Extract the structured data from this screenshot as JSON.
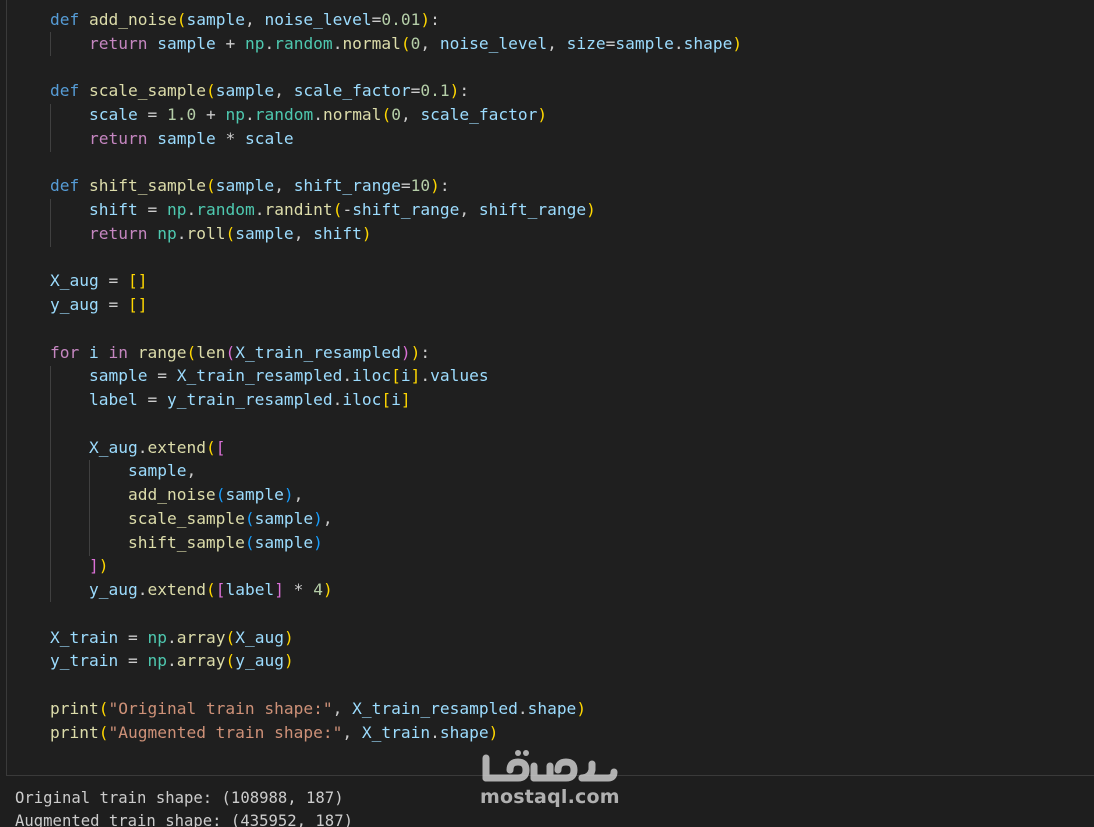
{
  "colors": {
    "background": "#1f1f1f",
    "keyword": "#569cd6",
    "control": "#c586c0",
    "function": "#dcdcaa",
    "variable": "#9cdcfe",
    "module": "#4ec9b0",
    "number": "#b5cea8",
    "string": "#ce9178",
    "plain": "#cccccc",
    "bracket_1": "#ffd700",
    "bracket_2": "#da70d6",
    "bracket_3": "#179fff"
  },
  "code_lines": [
    [
      [
        "def",
        "kw"
      ],
      [
        " ",
        "p"
      ],
      [
        "add_noise",
        "fn"
      ],
      [
        "(",
        "b1"
      ],
      [
        "sample",
        "v"
      ],
      [
        ", ",
        "p"
      ],
      [
        "noise_level",
        "v"
      ],
      [
        "=",
        "p"
      ],
      [
        "0.01",
        "n"
      ],
      [
        ")",
        "b1"
      ],
      [
        ":",
        "p"
      ]
    ],
    [
      [
        "    ",
        "p"
      ],
      [
        "return",
        "ctl"
      ],
      [
        " ",
        "p"
      ],
      [
        "sample",
        "v"
      ],
      [
        " + ",
        "p"
      ],
      [
        "np",
        "mod"
      ],
      [
        ".",
        "p"
      ],
      [
        "random",
        "mod"
      ],
      [
        ".",
        "p"
      ],
      [
        "normal",
        "fn"
      ],
      [
        "(",
        "b1"
      ],
      [
        "0",
        "n"
      ],
      [
        ", ",
        "p"
      ],
      [
        "noise_level",
        "v"
      ],
      [
        ", ",
        "p"
      ],
      [
        "size",
        "v"
      ],
      [
        "=",
        "p"
      ],
      [
        "sample",
        "v"
      ],
      [
        ".",
        "p"
      ],
      [
        "shape",
        "v"
      ],
      [
        ")",
        "b1"
      ]
    ],
    [],
    [
      [
        "def",
        "kw"
      ],
      [
        " ",
        "p"
      ],
      [
        "scale_sample",
        "fn"
      ],
      [
        "(",
        "b1"
      ],
      [
        "sample",
        "v"
      ],
      [
        ", ",
        "p"
      ],
      [
        "scale_factor",
        "v"
      ],
      [
        "=",
        "p"
      ],
      [
        "0.1",
        "n"
      ],
      [
        ")",
        "b1"
      ],
      [
        ":",
        "p"
      ]
    ],
    [
      [
        "    ",
        "p"
      ],
      [
        "scale",
        "v"
      ],
      [
        " = ",
        "p"
      ],
      [
        "1.0",
        "n"
      ],
      [
        " + ",
        "p"
      ],
      [
        "np",
        "mod"
      ],
      [
        ".",
        "p"
      ],
      [
        "random",
        "mod"
      ],
      [
        ".",
        "p"
      ],
      [
        "normal",
        "fn"
      ],
      [
        "(",
        "b1"
      ],
      [
        "0",
        "n"
      ],
      [
        ", ",
        "p"
      ],
      [
        "scale_factor",
        "v"
      ],
      [
        ")",
        "b1"
      ]
    ],
    [
      [
        "    ",
        "p"
      ],
      [
        "return",
        "ctl"
      ],
      [
        " ",
        "p"
      ],
      [
        "sample",
        "v"
      ],
      [
        " * ",
        "p"
      ],
      [
        "scale",
        "v"
      ]
    ],
    [],
    [
      [
        "def",
        "kw"
      ],
      [
        " ",
        "p"
      ],
      [
        "shift_sample",
        "fn"
      ],
      [
        "(",
        "b1"
      ],
      [
        "sample",
        "v"
      ],
      [
        ", ",
        "p"
      ],
      [
        "shift_range",
        "v"
      ],
      [
        "=",
        "p"
      ],
      [
        "10",
        "n"
      ],
      [
        ")",
        "b1"
      ],
      [
        ":",
        "p"
      ]
    ],
    [
      [
        "    ",
        "p"
      ],
      [
        "shift",
        "v"
      ],
      [
        " = ",
        "p"
      ],
      [
        "np",
        "mod"
      ],
      [
        ".",
        "p"
      ],
      [
        "random",
        "mod"
      ],
      [
        ".",
        "p"
      ],
      [
        "randint",
        "fn"
      ],
      [
        "(",
        "b1"
      ],
      [
        "-",
        "p"
      ],
      [
        "shift_range",
        "v"
      ],
      [
        ", ",
        "p"
      ],
      [
        "shift_range",
        "v"
      ],
      [
        ")",
        "b1"
      ]
    ],
    [
      [
        "    ",
        "p"
      ],
      [
        "return",
        "ctl"
      ],
      [
        " ",
        "p"
      ],
      [
        "np",
        "mod"
      ],
      [
        ".",
        "p"
      ],
      [
        "roll",
        "fn"
      ],
      [
        "(",
        "b1"
      ],
      [
        "sample",
        "v"
      ],
      [
        ", ",
        "p"
      ],
      [
        "shift",
        "v"
      ],
      [
        ")",
        "b1"
      ]
    ],
    [],
    [
      [
        "X_aug",
        "v"
      ],
      [
        " = ",
        "p"
      ],
      [
        "[]",
        "b1"
      ]
    ],
    [
      [
        "y_aug",
        "v"
      ],
      [
        " = ",
        "p"
      ],
      [
        "[]",
        "b1"
      ]
    ],
    [],
    [
      [
        "for",
        "ctl"
      ],
      [
        " ",
        "p"
      ],
      [
        "i",
        "v"
      ],
      [
        " ",
        "p"
      ],
      [
        "in",
        "ctl"
      ],
      [
        " ",
        "p"
      ],
      [
        "range",
        "fn"
      ],
      [
        "(",
        "b1"
      ],
      [
        "len",
        "fn"
      ],
      [
        "(",
        "b2"
      ],
      [
        "X_train_resampled",
        "v"
      ],
      [
        ")",
        "b2"
      ],
      [
        ")",
        "b1"
      ],
      [
        ":",
        "p"
      ]
    ],
    [
      [
        "    ",
        "p"
      ],
      [
        "sample",
        "v"
      ],
      [
        " = ",
        "p"
      ],
      [
        "X_train_resampled",
        "v"
      ],
      [
        ".",
        "p"
      ],
      [
        "iloc",
        "v"
      ],
      [
        "[",
        "b1"
      ],
      [
        "i",
        "v"
      ],
      [
        "]",
        "b1"
      ],
      [
        ".",
        "p"
      ],
      [
        "values",
        "v"
      ]
    ],
    [
      [
        "    ",
        "p"
      ],
      [
        "label",
        "v"
      ],
      [
        " = ",
        "p"
      ],
      [
        "y_train_resampled",
        "v"
      ],
      [
        ".",
        "p"
      ],
      [
        "iloc",
        "v"
      ],
      [
        "[",
        "b1"
      ],
      [
        "i",
        "v"
      ],
      [
        "]",
        "b1"
      ]
    ],
    [],
    [
      [
        "    ",
        "p"
      ],
      [
        "X_aug",
        "v"
      ],
      [
        ".",
        "p"
      ],
      [
        "extend",
        "fn"
      ],
      [
        "(",
        "b1"
      ],
      [
        "[",
        "b2"
      ]
    ],
    [
      [
        "        ",
        "p"
      ],
      [
        "sample",
        "v"
      ],
      [
        ",",
        "p"
      ]
    ],
    [
      [
        "        ",
        "p"
      ],
      [
        "add_noise",
        "fn"
      ],
      [
        "(",
        "b3"
      ],
      [
        "sample",
        "v"
      ],
      [
        ")",
        "b3"
      ],
      [
        ",",
        "p"
      ]
    ],
    [
      [
        "        ",
        "p"
      ],
      [
        "scale_sample",
        "fn"
      ],
      [
        "(",
        "b3"
      ],
      [
        "sample",
        "v"
      ],
      [
        ")",
        "b3"
      ],
      [
        ",",
        "p"
      ]
    ],
    [
      [
        "        ",
        "p"
      ],
      [
        "shift_sample",
        "fn"
      ],
      [
        "(",
        "b3"
      ],
      [
        "sample",
        "v"
      ],
      [
        ")",
        "b3"
      ]
    ],
    [
      [
        "    ",
        "p"
      ],
      [
        "]",
        "b2"
      ],
      [
        ")",
        "b1"
      ]
    ],
    [
      [
        "    ",
        "p"
      ],
      [
        "y_aug",
        "v"
      ],
      [
        ".",
        "p"
      ],
      [
        "extend",
        "fn"
      ],
      [
        "(",
        "b1"
      ],
      [
        "[",
        "b2"
      ],
      [
        "label",
        "v"
      ],
      [
        "]",
        "b2"
      ],
      [
        " * ",
        "p"
      ],
      [
        "4",
        "n"
      ],
      [
        ")",
        "b1"
      ]
    ],
    [],
    [
      [
        "X_train",
        "v"
      ],
      [
        " = ",
        "p"
      ],
      [
        "np",
        "mod"
      ],
      [
        ".",
        "p"
      ],
      [
        "array",
        "fn"
      ],
      [
        "(",
        "b1"
      ],
      [
        "X_aug",
        "v"
      ],
      [
        ")",
        "b1"
      ]
    ],
    [
      [
        "y_train",
        "v"
      ],
      [
        " = ",
        "p"
      ],
      [
        "np",
        "mod"
      ],
      [
        ".",
        "p"
      ],
      [
        "array",
        "fn"
      ],
      [
        "(",
        "b1"
      ],
      [
        "y_aug",
        "v"
      ],
      [
        ")",
        "b1"
      ]
    ],
    [],
    [
      [
        "print",
        "fn"
      ],
      [
        "(",
        "b1"
      ],
      [
        "\"Original train shape:\"",
        "s"
      ],
      [
        ", ",
        "p"
      ],
      [
        "X_train_resampled",
        "v"
      ],
      [
        ".",
        "p"
      ],
      [
        "shape",
        "v"
      ],
      [
        ")",
        "b1"
      ]
    ],
    [
      [
        "print",
        "fn"
      ],
      [
        "(",
        "b1"
      ],
      [
        "\"Augmented train shape:\"",
        "s"
      ],
      [
        ", ",
        "p"
      ],
      [
        "X_train",
        "v"
      ],
      [
        ".",
        "p"
      ],
      [
        "shape",
        "v"
      ],
      [
        ")",
        "b1"
      ]
    ]
  ],
  "output": {
    "line1": "Original train shape: (108988, 187)",
    "line2": "Augmented train shape: (435952, 187)"
  },
  "watermark": {
    "arabic": "مستقل",
    "latin": "mostaql.com"
  }
}
